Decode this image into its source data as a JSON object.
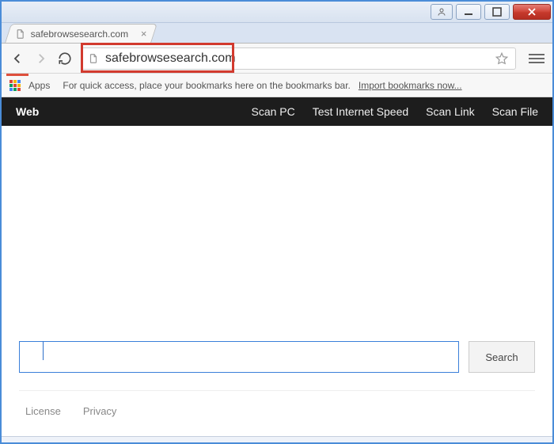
{
  "window": {
    "tab_title": "safebrowsesearch.com"
  },
  "addressbar": {
    "url": "safebrowsesearch.com"
  },
  "bookmarks": {
    "apps_label": "Apps",
    "hint": "For quick access, place your bookmarks here on the bookmarks bar.",
    "import_link": "Import bookmarks now..."
  },
  "site_nav": {
    "brand": "Web",
    "links": [
      "Scan PC",
      "Test Internet Speed",
      "Scan Link",
      "Scan File"
    ]
  },
  "search": {
    "input_value": "",
    "button_label": "Search"
  },
  "footer": {
    "links": [
      "License",
      "Privacy"
    ]
  }
}
